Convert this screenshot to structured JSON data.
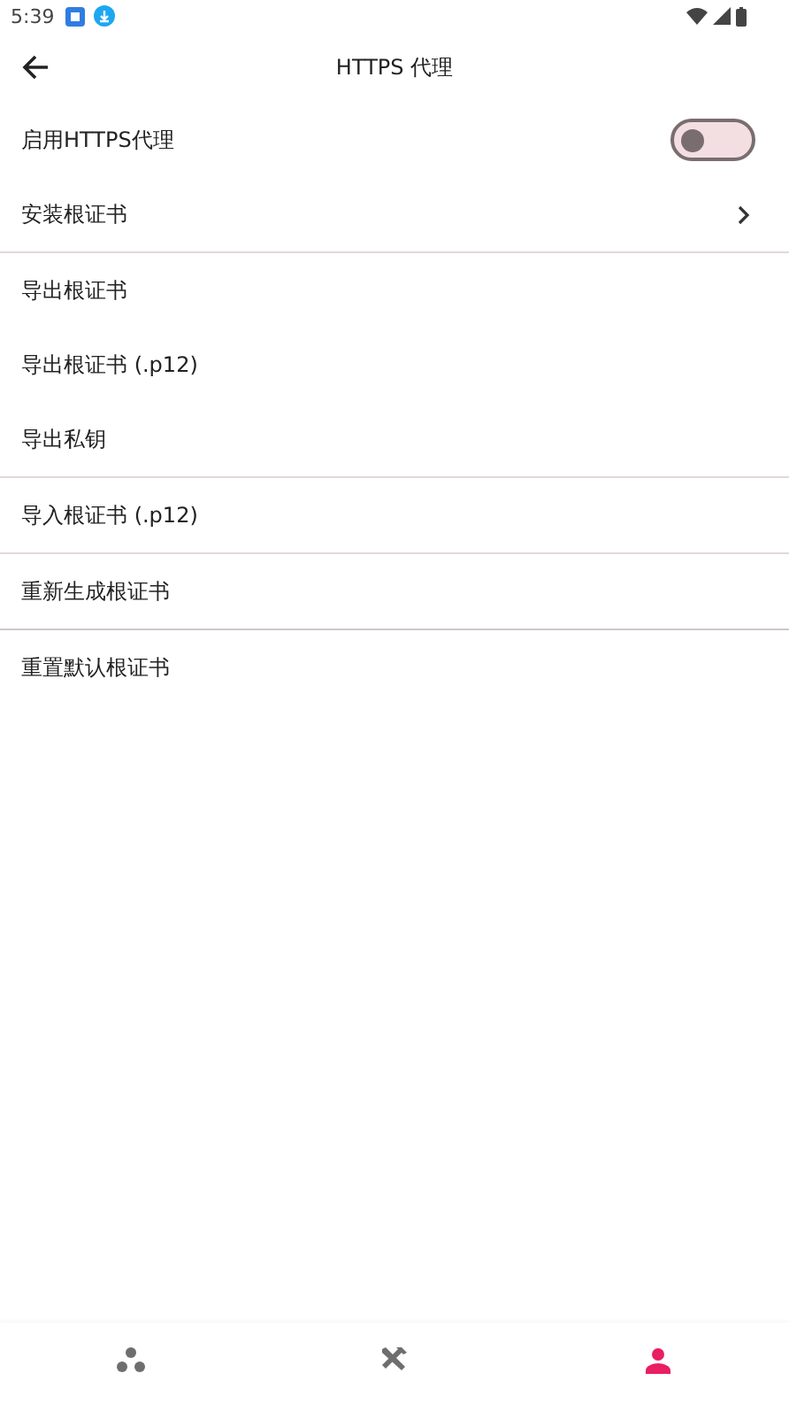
{
  "status_bar": {
    "time": "5:39"
  },
  "app_bar": {
    "title": "HTTPS 代理"
  },
  "sections": [
    {
      "items": [
        {
          "kind": "switch",
          "label": "启用HTTPS代理",
          "on": false
        },
        {
          "kind": "link",
          "label": "安装根证书"
        }
      ]
    },
    {
      "items": [
        {
          "kind": "plain",
          "label": "导出根证书"
        },
        {
          "kind": "plain",
          "label": "导出根证书 (.p12)"
        },
        {
          "kind": "plain",
          "label": "导出私钥"
        }
      ]
    },
    {
      "items": [
        {
          "kind": "plain",
          "label": "导入根证书 (.p12)"
        }
      ]
    },
    {
      "items": [
        {
          "kind": "plain",
          "label": "重新生成根证书"
        }
      ]
    },
    {
      "items": [
        {
          "kind": "plain",
          "label": "重置默认根证书"
        }
      ]
    }
  ],
  "bottom_nav": [
    {
      "kind": "dots",
      "selected": false
    },
    {
      "kind": "tools",
      "selected": false
    },
    {
      "kind": "person",
      "selected": true
    }
  ]
}
